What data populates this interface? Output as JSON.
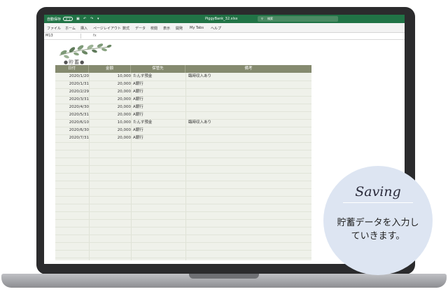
{
  "window": {
    "autosave_label": "自動保存",
    "autosave_state": "オフ",
    "file_name": "PiggyBank_32.xlsx",
    "search_placeholder": "検索"
  },
  "ribbon": {
    "tabs": [
      "ファイル",
      "ホーム",
      "挿入",
      "ページレイアウト",
      "数式",
      "データ",
      "校閲",
      "表示",
      "開発",
      "My Tabs",
      "ヘルプ"
    ]
  },
  "formula_bar": {
    "cell_ref": "M13",
    "fx": "fx"
  },
  "sheet": {
    "title": "●貯蓄●",
    "headers": [
      "日付",
      "金額",
      "保管先",
      "備考"
    ],
    "rows": [
      {
        "date": "2020/1/20",
        "amount": "10,000",
        "place": "たんす預金",
        "note": "臨時収入あり"
      },
      {
        "date": "2020/1/31",
        "amount": "20,000",
        "place": "A銀行",
        "note": ""
      },
      {
        "date": "2020/2/29",
        "amount": "20,000",
        "place": "A銀行",
        "note": ""
      },
      {
        "date": "2020/3/31",
        "amount": "20,000",
        "place": "A銀行",
        "note": ""
      },
      {
        "date": "2020/4/30",
        "amount": "20,000",
        "place": "A銀行",
        "note": ""
      },
      {
        "date": "2020/5/31",
        "amount": "20,000",
        "place": "A銀行",
        "note": ""
      },
      {
        "date": "2020/6/10",
        "amount": "10,000",
        "place": "たんす預金",
        "note": "臨時収入あり"
      },
      {
        "date": "2020/6/30",
        "amount": "20,000",
        "place": "A銀行",
        "note": ""
      },
      {
        "date": "2020/7/31",
        "amount": "20,000",
        "place": "A銀行",
        "note": ""
      }
    ]
  },
  "callout": {
    "title": "Saving",
    "line1": "貯蓄データを入力し",
    "line2": "ていきます。"
  },
  "colors": {
    "excel_green": "#217346",
    "header_olive": "#858a6f",
    "sheet_bg": "#eff1ea",
    "bubble_bg": "#dde5f2"
  }
}
